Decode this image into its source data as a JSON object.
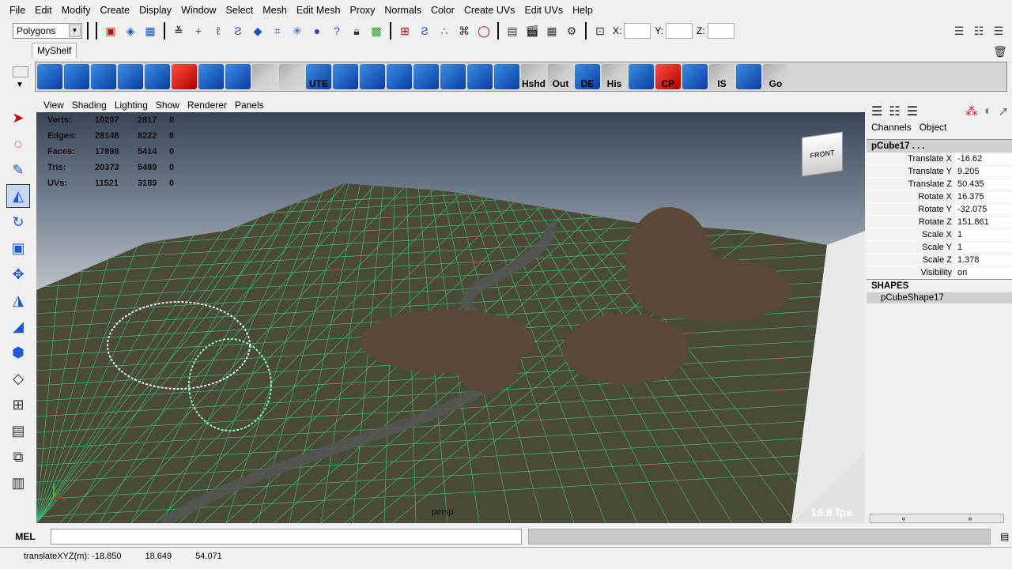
{
  "menubar": [
    "File",
    "Edit",
    "Modify",
    "Create",
    "Display",
    "Window",
    "Select",
    "Mesh",
    "Edit Mesh",
    "Proxy",
    "Normals",
    "Color",
    "Create UVs",
    "Edit UVs",
    "Help"
  ],
  "status": {
    "menu_set": "Polygons",
    "x_label": "X:",
    "y_label": "Y:",
    "z_label": "Z:"
  },
  "shelf": {
    "tab": "MyShelf",
    "labels": {
      "ute": "UTE",
      "hshd": "Hshd",
      "out": "Out",
      "de": "DE",
      "his": "His",
      "cp": "CP",
      "is": "IS",
      "go": "Go"
    }
  },
  "panel_menu": [
    "View",
    "Shading",
    "Lighting",
    "Show",
    "Renderer",
    "Panels"
  ],
  "hud": {
    "rows": [
      {
        "label": "Verts:",
        "a": "10207",
        "b": "2817",
        "c": "0"
      },
      {
        "label": "Edges:",
        "a": "28148",
        "b": "8222",
        "c": "0"
      },
      {
        "label": "Faces:",
        "a": "17898",
        "b": "5414",
        "c": "0"
      },
      {
        "label": "Tris:",
        "a": "20373",
        "b": "5489",
        "c": "0"
      },
      {
        "label": "UVs:",
        "a": "11521",
        "b": "3189",
        "c": "0"
      }
    ],
    "fps": "16.8 fps",
    "camera": "persp",
    "viewcube": "FRONT"
  },
  "channel_box": {
    "menu": [
      "Channels",
      "Object"
    ],
    "object": "pCube17 . . .",
    "attrs": [
      {
        "name": "Translate X",
        "value": "-16.62"
      },
      {
        "name": "Translate Y",
        "value": "9.205"
      },
      {
        "name": "Translate Z",
        "value": "50.435"
      },
      {
        "name": "Rotate X",
        "value": "16.375"
      },
      {
        "name": "Rotate Y",
        "value": "-32.075"
      },
      {
        "name": "Rotate Z",
        "value": "151.861"
      },
      {
        "name": "Scale X",
        "value": "1"
      },
      {
        "name": "Scale Y",
        "value": "1"
      },
      {
        "name": "Scale Z",
        "value": "1.378"
      },
      {
        "name": "Visibility",
        "value": "on"
      }
    ],
    "shapes_header": "SHAPES",
    "shape": "pCubeShape17"
  },
  "command_line": {
    "label": "MEL",
    "value": ""
  },
  "help_line": {
    "label": "translateXYZ(m): -18.850",
    "y": "18.649",
    "z": "54.071"
  }
}
